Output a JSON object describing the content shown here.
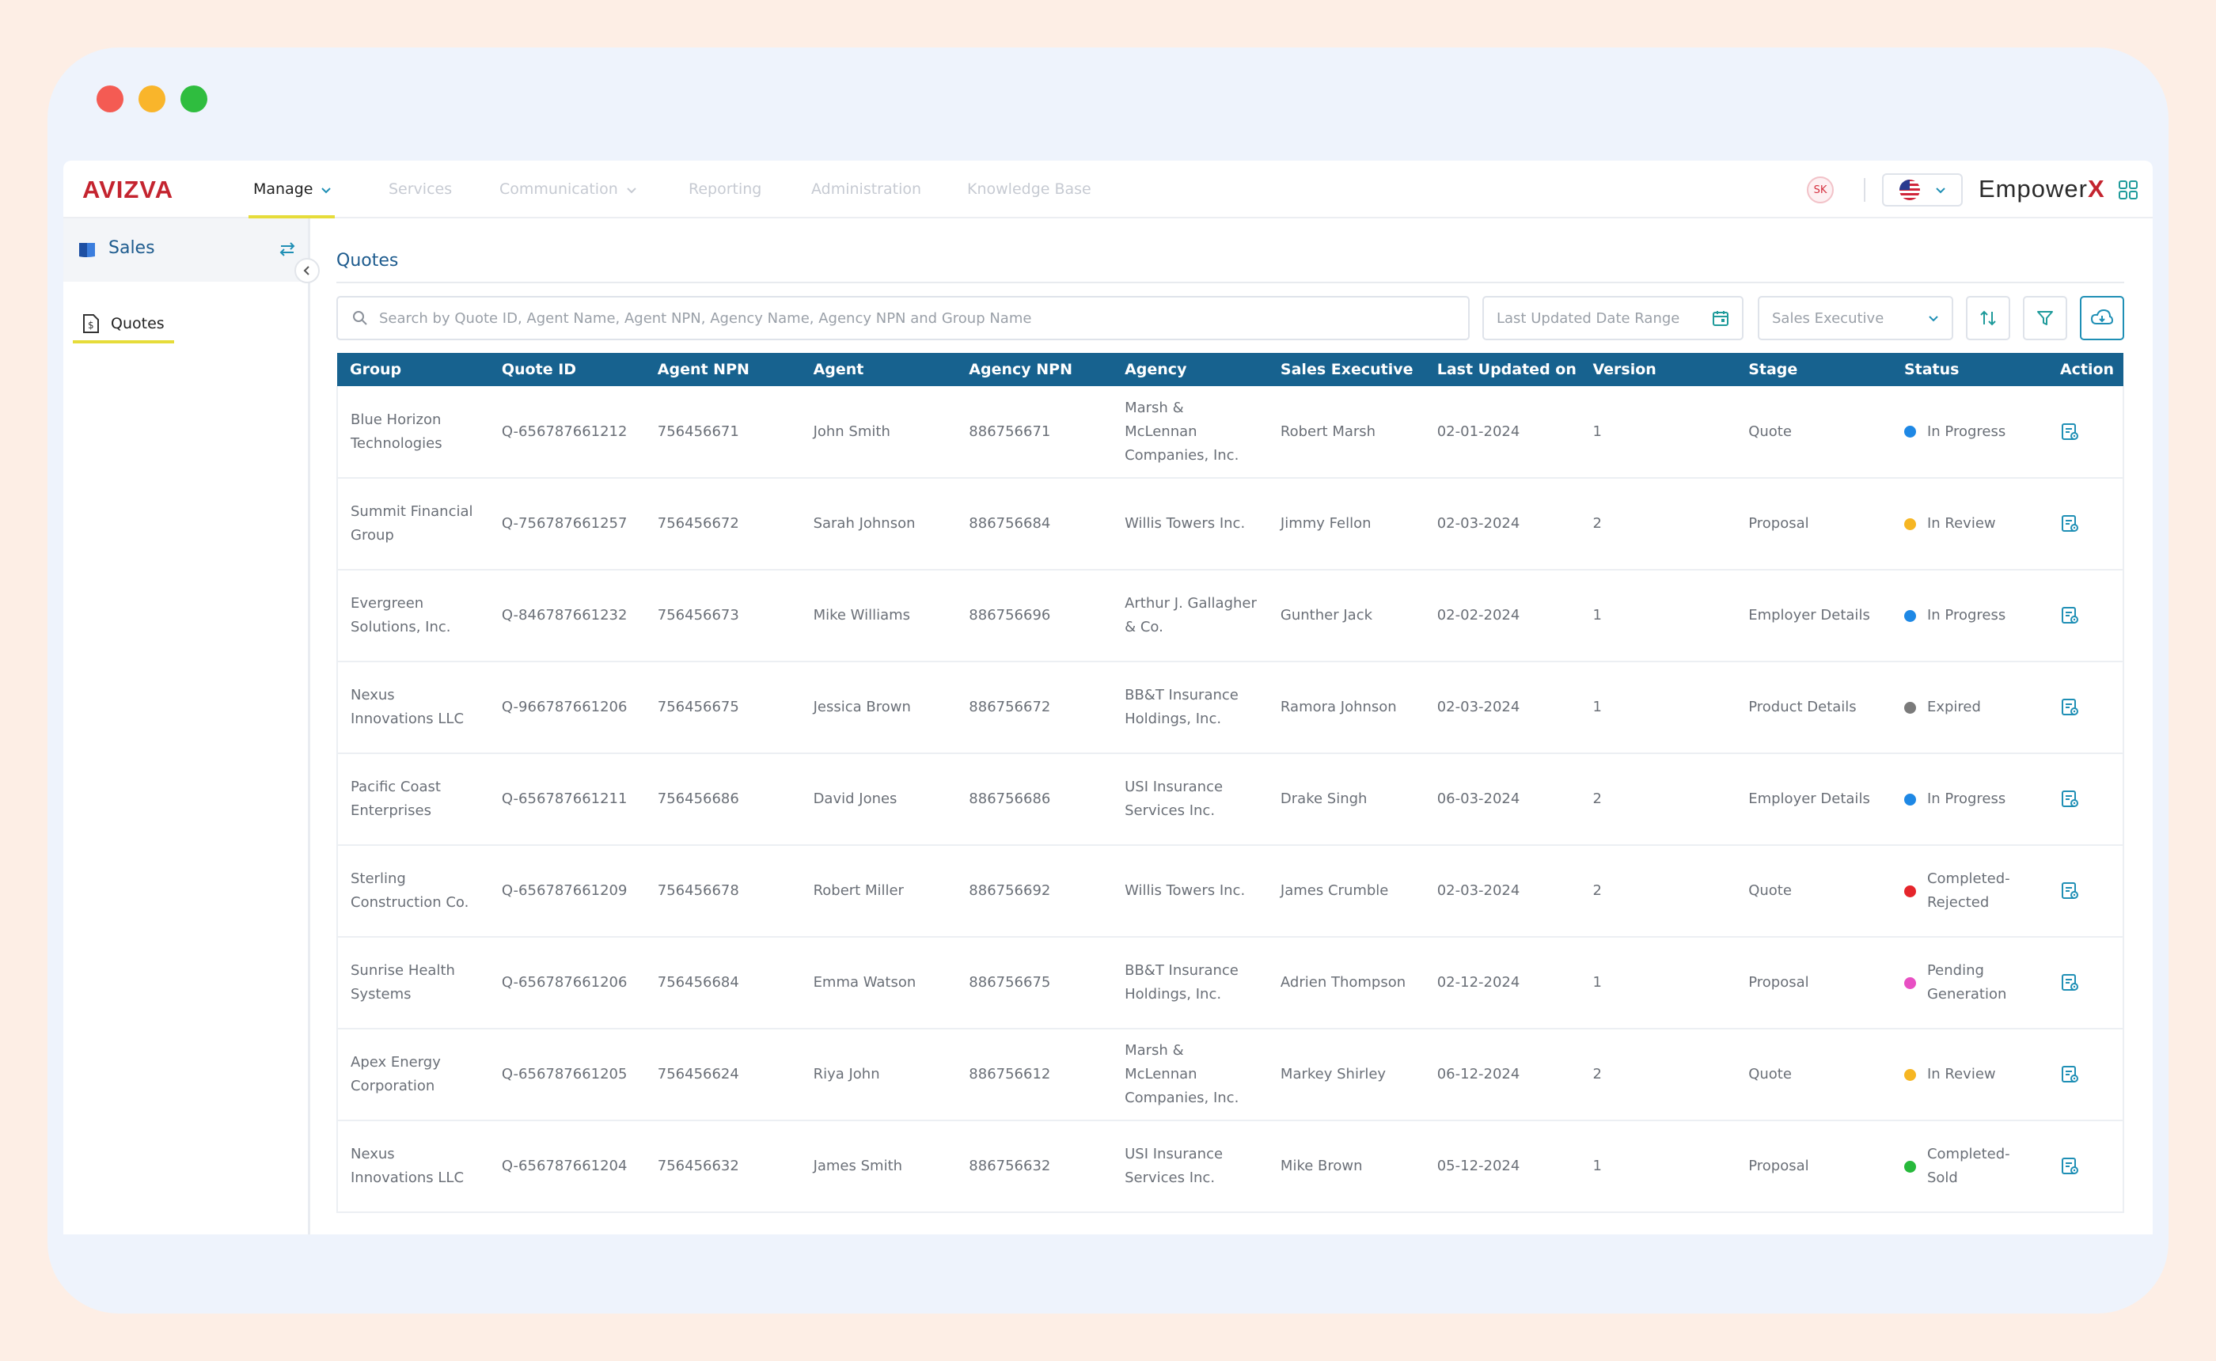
{
  "nav": {
    "logo": "AVIZVA",
    "items": [
      {
        "label": "Manage",
        "active": true,
        "dropdown": true
      },
      {
        "label": "Services",
        "active": false,
        "dropdown": false
      },
      {
        "label": "Communication",
        "active": false,
        "dropdown": true
      },
      {
        "label": "Reporting",
        "active": false,
        "dropdown": false
      },
      {
        "label": "Administration",
        "active": false,
        "dropdown": false
      },
      {
        "label": "Knowledge Base",
        "active": false,
        "dropdown": false
      }
    ],
    "avatar": "SK",
    "language_icon": "us-flag-icon",
    "brand_prefix": "Empower",
    "brand_suffix": "X"
  },
  "sidebar": {
    "title": "Sales",
    "items": [
      {
        "label": "Quotes",
        "icon": "document-dollar-icon",
        "active": true
      }
    ]
  },
  "main": {
    "title": "Quotes",
    "search_placeholder": "Search by Quote ID, Agent Name, Agent NPN, Agency Name, Agency NPN and Group Name",
    "date_range_placeholder": "Last Updated Date Range",
    "sales_exec_placeholder": "Sales Executive"
  },
  "table": {
    "columns": [
      "Group",
      "Quote ID",
      "Agent NPN",
      "Agent",
      "Agency NPN",
      "Agency",
      "Sales Executive",
      "Last Updated on",
      "Version",
      "Stage",
      "Status",
      "Action"
    ],
    "rows": [
      {
        "group": "Blue Horizon Technologies",
        "quote_id": "Q-656787661212",
        "agent_npn": "756456671",
        "agent": "John Smith",
        "agency_npn": "886756671",
        "agency": "Marsh & McLennan Companies, Inc.",
        "sales_exec": "Robert Marsh",
        "updated": "02-01-2024",
        "version": "1",
        "stage": "Quote",
        "status": "In Progress",
        "status_color": "#1e88e5"
      },
      {
        "group": "Summit Financial Group",
        "quote_id": "Q-756787661257",
        "agent_npn": "756456672",
        "agent": "Sarah Johnson",
        "agency_npn": "886756684",
        "agency": "Willis Towers Inc.",
        "sales_exec": "Jimmy Fellon",
        "updated": "02-03-2024",
        "version": "2",
        "stage": "Proposal",
        "status": "In Review",
        "status_color": "#f6b623"
      },
      {
        "group": "Evergreen Solutions, Inc.",
        "quote_id": "Q-846787661232",
        "agent_npn": "756456673",
        "agent": "Mike Williams",
        "agency_npn": "886756696",
        "agency": "Arthur J. Gallagher & Co.",
        "sales_exec": "Gunther Jack",
        "updated": "02-02-2024",
        "version": "1",
        "stage": "Employer Details",
        "status": "In Progress",
        "status_color": "#1e88e5"
      },
      {
        "group": "Nexus Innovations LLC",
        "quote_id": "Q-966787661206",
        "agent_npn": "756456675",
        "agent": "Jessica Brown",
        "agency_npn": "886756672",
        "agency": "BB&T Insurance Holdings, Inc.",
        "sales_exec": "Ramora Johnson",
        "updated": "02-03-2024",
        "version": "1",
        "stage": "Product Details",
        "status": "Expired",
        "status_color": "#7a7a7a"
      },
      {
        "group": "Pacific Coast Enterprises",
        "quote_id": "Q-656787661211",
        "agent_npn": "756456686",
        "agent": "David Jones",
        "agency_npn": "886756686",
        "agency": "USI Insurance Services Inc.",
        "sales_exec": "Drake Singh",
        "updated": "06-03-2024",
        "version": "2",
        "stage": "Employer Details",
        "status": "In Progress",
        "status_color": "#1e88e5"
      },
      {
        "group": "Sterling Construction Co.",
        "quote_id": "Q-656787661209",
        "agent_npn": "756456678",
        "agent": "Robert Miller",
        "agency_npn": "886756692",
        "agency": "Willis Towers Inc.",
        "sales_exec": "James Crumble",
        "updated": "02-03-2024",
        "version": "2",
        "stage": "Quote",
        "status": "Completed-Rejected",
        "status_color": "#e5252b"
      },
      {
        "group": "Sunrise Health Systems",
        "quote_id": "Q-656787661206",
        "agent_npn": "756456684",
        "agent": "Emma Watson",
        "agency_npn": "886756675",
        "agency": "BB&T Insurance Holdings, Inc.",
        "sales_exec": "Adrien Thompson",
        "updated": "02-12-2024",
        "version": "1",
        "stage": "Proposal",
        "status": "Pending Generation",
        "status_color": "#e84fc3"
      },
      {
        "group": "Apex Energy Corporation",
        "quote_id": "Q-656787661205",
        "agent_npn": "756456624",
        "agent": "Riya John",
        "agency_npn": "886756612",
        "agency": "Marsh & McLennan Companies, Inc.",
        "sales_exec": "Markey Shirley",
        "updated": "06-12-2024",
        "version": "2",
        "stage": "Quote",
        "status": "In Review",
        "status_color": "#f6b623"
      },
      {
        "group": "Nexus Innovations LLC",
        "quote_id": "Q-656787661204",
        "agent_npn": "756456632",
        "agent": "James Smith",
        "agency_npn": "886756632",
        "agency": "USI Insurance Services Inc.",
        "sales_exec": "Mike Brown",
        "updated": "05-12-2024",
        "version": "1",
        "stage": "Proposal",
        "status": "Completed-Sold",
        "status_color": "#27b93b"
      }
    ]
  },
  "colors": {
    "header_bg": "#17628f",
    "accent_underline": "#e6dc3a",
    "title_blue": "#1d5b8e",
    "brand_red": "#c4242f"
  }
}
